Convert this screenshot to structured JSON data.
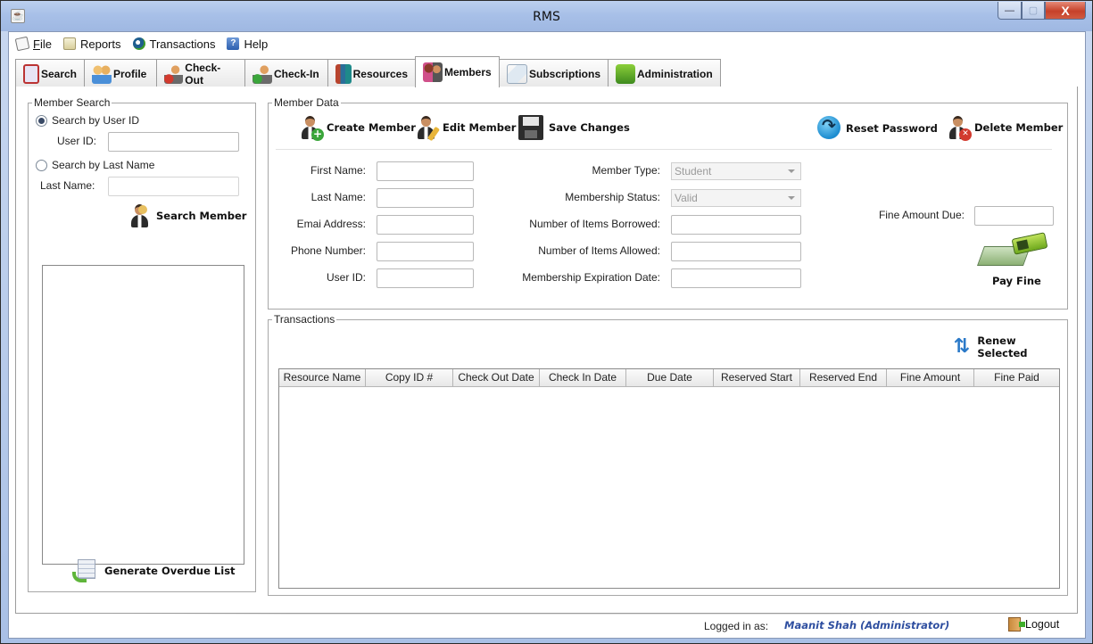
{
  "window": {
    "title": "RMS",
    "controls": {
      "minimize": "—",
      "maximize": "▢",
      "close": "X"
    }
  },
  "menubar": [
    {
      "label": "File",
      "mnemonic": "F",
      "rest": "ile",
      "icon": "file-icon"
    },
    {
      "label": "Reports",
      "icon": "reports-icon"
    },
    {
      "label": "Transactions",
      "icon": "transactions-icon"
    },
    {
      "label": "Help",
      "icon": "help-icon"
    }
  ],
  "tabs": [
    {
      "label": "Search",
      "icon": "search-icon"
    },
    {
      "label": "Profile",
      "icon": "profile-icon"
    },
    {
      "label": "Check-Out",
      "icon": "check-out-icon"
    },
    {
      "label": "Check-In",
      "icon": "check-in-icon"
    },
    {
      "label": "Resources",
      "icon": "resources-icon"
    },
    {
      "label": "Members",
      "icon": "members-icon",
      "active": true
    },
    {
      "label": "Subscriptions",
      "icon": "subscriptions-icon"
    },
    {
      "label": "Administration",
      "icon": "administration-icon"
    }
  ],
  "member_search": {
    "title": "Member Search",
    "radio_user_id": "Search by User ID",
    "radio_user_id_selected": true,
    "user_id_label": "User ID:",
    "user_id_value": "",
    "radio_last_name": "Search by Last Name",
    "radio_last_name_selected": false,
    "last_name_label": "Last Name:",
    "last_name_value": "",
    "search_button": "Search Member",
    "results": [],
    "overdue_button": "Generate Overdue List"
  },
  "member_data": {
    "title": "Member Data",
    "toolbar": {
      "create": "Create Member",
      "edit": "Edit Member",
      "save": "Save Changes",
      "reset_password": "Reset Password",
      "delete": "Delete Member"
    },
    "fields_left": [
      {
        "label": "First Name:",
        "value": ""
      },
      {
        "label": "Last Name:",
        "value": ""
      },
      {
        "label": "Emai Address:",
        "value": ""
      },
      {
        "label": "Phone Number:",
        "value": ""
      },
      {
        "label": "User ID:",
        "value": ""
      }
    ],
    "fields_right": [
      {
        "label": "Member Type:",
        "value": "Student",
        "type": "combo"
      },
      {
        "label": "Membership Status:",
        "value": "Valid",
        "type": "combo"
      },
      {
        "label": "Number of Items Borrowed:",
        "value": ""
      },
      {
        "label": "Number of Items Allowed:",
        "value": ""
      },
      {
        "label": "Membership Expiration Date:",
        "value": ""
      }
    ],
    "fine_label": "Fine Amount Due:",
    "fine_value": "",
    "pay_fine": "Pay Fine"
  },
  "transactions": {
    "title": "Transactions",
    "renew_button": "Renew Selected",
    "columns": [
      "Resource Name",
      "Copy ID #",
      "Check Out Date",
      "Check In Date",
      "Due Date",
      "Reserved Start",
      "Reserved End",
      "Fine Amount",
      "Fine Paid"
    ],
    "rows": []
  },
  "status": {
    "logged_in_label": "Logged in as:",
    "user": "Maanit Shah (Administrator)",
    "logout": "Logout"
  },
  "colors": {
    "titlebar": "#a8c0e8",
    "close_button": "#c6412a",
    "user_text": "#2f4fa0"
  }
}
